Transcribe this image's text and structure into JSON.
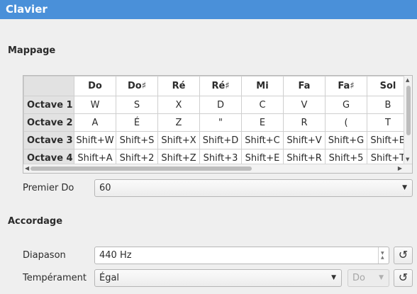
{
  "window": {
    "title": "Clavier"
  },
  "mapping": {
    "section_title": "Mappage",
    "columns": [
      "Do",
      "Do♯",
      "Ré",
      "Ré♯",
      "Mi",
      "Fa",
      "Fa♯",
      "Sol"
    ],
    "rows": [
      {
        "header": "Octave 1",
        "cells": [
          "W",
          "S",
          "X",
          "D",
          "C",
          "V",
          "G",
          "B"
        ]
      },
      {
        "header": "Octave 2",
        "cells": [
          "A",
          "É",
          "Z",
          "\"",
          "E",
          "R",
          "(",
          "T"
        ]
      },
      {
        "header": "Octave 3",
        "cells": [
          "Shift+W",
          "Shift+S",
          "Shift+X",
          "Shift+D",
          "Shift+C",
          "Shift+V",
          "Shift+G",
          "Shift+B"
        ]
      },
      {
        "header": "Octave 4",
        "cells": [
          "Shift+A",
          "Shift+2",
          "Shift+Z",
          "Shift+3",
          "Shift+E",
          "Shift+R",
          "Shift+5",
          "Shift+T"
        ]
      }
    ],
    "first_do": {
      "label": "Premier Do",
      "value": "60"
    }
  },
  "tuning": {
    "section_title": "Accordage",
    "diapason": {
      "label": "Diapason",
      "value": "440 Hz"
    },
    "temperament": {
      "label": "Tempérament",
      "value": "Égal",
      "note_value": "Do"
    }
  },
  "icons": {
    "reset": "reset-icon",
    "dropdown": "chevron-down-icon"
  }
}
